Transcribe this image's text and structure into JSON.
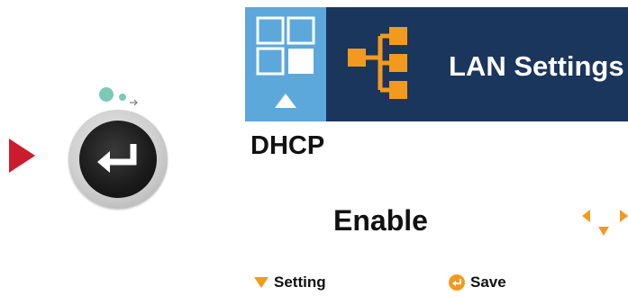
{
  "header": {
    "title": "LAN Settings"
  },
  "setting": {
    "name": "DHCP",
    "value": "Enable"
  },
  "footer": {
    "left_label": "Setting",
    "right_label": "Save"
  },
  "icons": {
    "pointer": "right-triangle-icon",
    "enter_key": "enter-key-icon",
    "menu": "menu-grid-icon",
    "lan": "network-tree-icon",
    "nav": "left-down-right-arrows-icon",
    "down": "down-triangle-icon",
    "save": "enter-circle-icon"
  },
  "colors": {
    "header_bg": "#1b365c",
    "menu_tile_bg": "#5ca8db",
    "accent_orange": "#f29a1e",
    "pointer_red": "#cc1b2e"
  }
}
